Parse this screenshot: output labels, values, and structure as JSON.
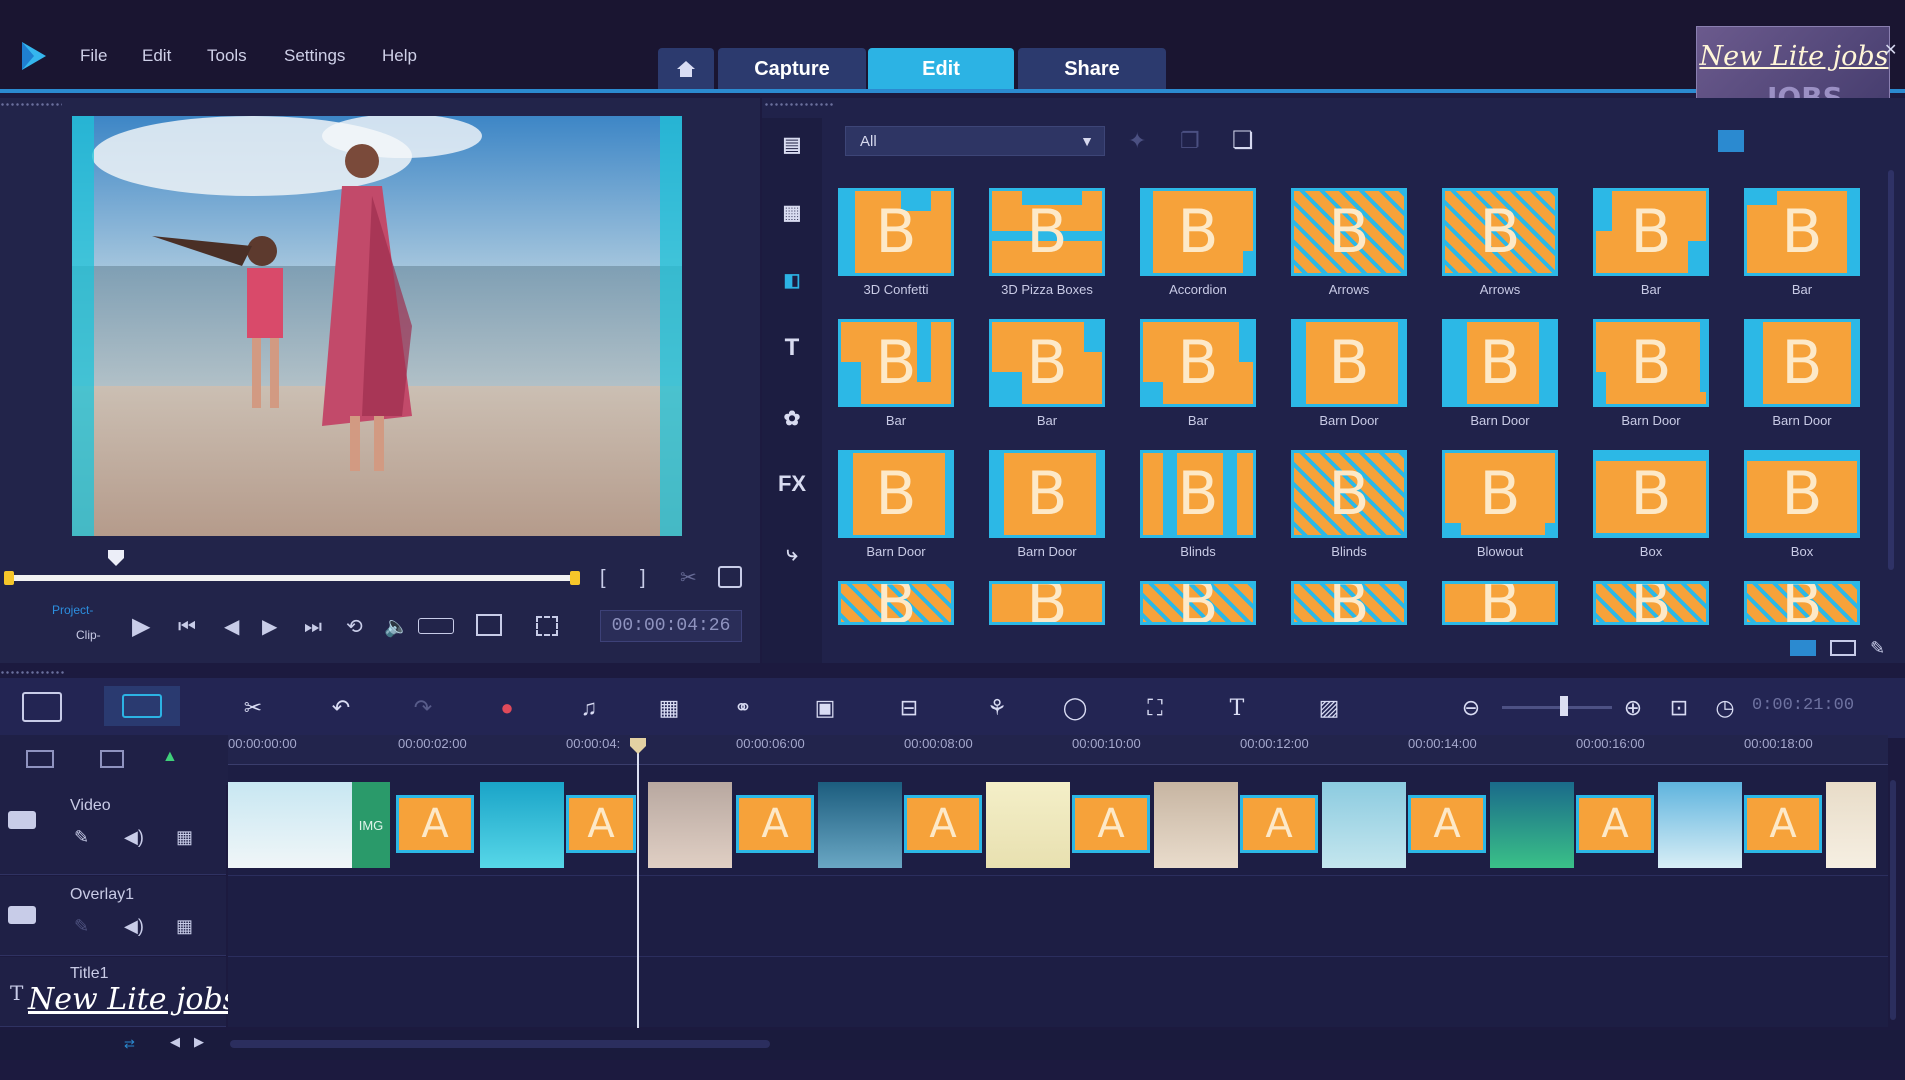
{
  "menu": [
    "File",
    "Edit",
    "Tools",
    "Settings",
    "Help"
  ],
  "tabs": {
    "capture": "Capture",
    "edit": "Edit",
    "share": "Share"
  },
  "watermark": "New Lite jobs",
  "preview": {
    "mode_project": "Project-",
    "mode_clip": "Clip-",
    "timecode": "00:00:04:26"
  },
  "library": {
    "dropdown_value": "All",
    "side_fx": "FX",
    "side_title": "T",
    "transitions": [
      {
        "label": "3D Confetti"
      },
      {
        "label": "3D Pizza Boxes"
      },
      {
        "label": "Accordion"
      },
      {
        "label": "Arrows"
      },
      {
        "label": "Arrows"
      },
      {
        "label": "Bar"
      },
      {
        "label": "Bar"
      },
      {
        "label": "Bar"
      },
      {
        "label": "Bar"
      },
      {
        "label": "Bar"
      },
      {
        "label": "Barn Door"
      },
      {
        "label": "Barn Door"
      },
      {
        "label": "Barn Door"
      },
      {
        "label": "Barn Door"
      },
      {
        "label": "Barn Door"
      },
      {
        "label": "Barn Door"
      },
      {
        "label": "Blinds"
      },
      {
        "label": "Blinds"
      },
      {
        "label": "Blowout"
      },
      {
        "label": "Box"
      },
      {
        "label": "Box"
      },
      {
        "label": ""
      },
      {
        "label": ""
      },
      {
        "label": ""
      },
      {
        "label": ""
      },
      {
        "label": ""
      },
      {
        "label": ""
      },
      {
        "label": ""
      }
    ]
  },
  "timeline": {
    "duration": "0:00:21:00",
    "ruler": [
      "00:00:00:00",
      "00:00:02:00",
      "00:00:04:",
      "00:00:06:00",
      "00:00:08:00",
      "00:00:10:00",
      "00:00:12:00",
      "00:00:14:00",
      "00:00:16:00",
      "00:00:18:00"
    ],
    "tracks": {
      "video": "Video",
      "overlay": "Overlay1",
      "title": "Title1"
    },
    "img_badge": "IMG",
    "title_icon": "T"
  },
  "colors": {
    "accent_blue": "#2cb3e4",
    "thumb_orange": "#f6a23a",
    "background": "#1c1a3f"
  }
}
